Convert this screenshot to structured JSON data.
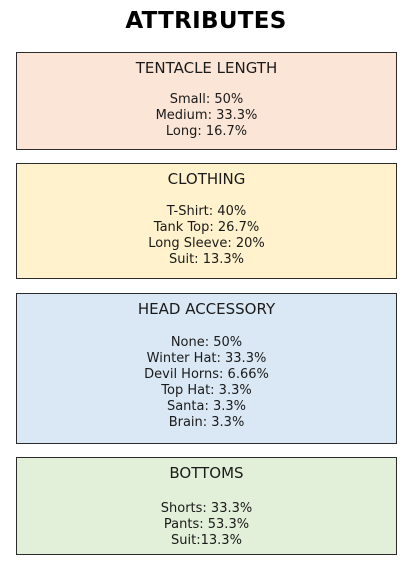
{
  "title": "ATTRIBUTES",
  "sections": [
    {
      "heading": "TENTACLE LENGTH",
      "fill": "#fbe5d6",
      "items": [
        "Small: 50%",
        "Medium: 33.3%",
        "Long: 16.7%"
      ]
    },
    {
      "heading": "CLOTHING",
      "fill": "#fff2cc",
      "items": [
        "T-Shirt: 40%",
        "Tank Top: 26.7%",
        "Long Sleeve: 20%",
        "Suit: 13.3%"
      ]
    },
    {
      "heading": "HEAD ACCESSORY",
      "fill": "#dae8f5",
      "items": [
        "None: 50%",
        "Winter Hat: 33.3%",
        "Devil Horns: 6.66%",
        "Top Hat: 3.3%",
        "Santa: 3.3%",
        "Brain: 3.3%"
      ]
    },
    {
      "heading": "BOTTOMS",
      "fill": "#e2efd9",
      "items": [
        "Shorts: 33.3%",
        "Pants: 53.3%",
        "Suit:13.3%"
      ]
    }
  ]
}
